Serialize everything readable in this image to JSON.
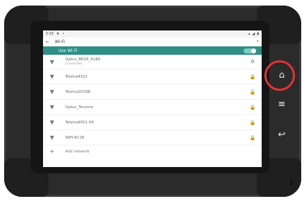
{
  "status_bar": {
    "time": "5:33",
    "left_icons": [
      "gear-icon",
      "pin-icon"
    ],
    "right_icons": [
      "wifi-icon",
      "signal-icon",
      "battery-icon"
    ]
  },
  "app_bar": {
    "back_icon": "back-arrow-icon",
    "title": "Wi-Fi",
    "search_icon": "search-icon"
  },
  "use_wifi": {
    "label": "Use Wi-Fi",
    "enabled": true
  },
  "networks": [
    {
      "name": "Optus_BR16_4180",
      "status": "Connected",
      "connected": true
    },
    {
      "name": "Telstra4321"
    },
    {
      "name": "Telstra2D298"
    },
    {
      "name": "Optus_Tecoma"
    },
    {
      "name": "Telstra4001-56"
    },
    {
      "name": "WiFi-6C26"
    }
  ],
  "add_network": {
    "label": "Add network"
  },
  "hardware_buttons": {
    "home": "home-icon",
    "menu": "menu-icon",
    "back": "back-icon"
  },
  "colors": {
    "accent": "#2f8f86",
    "highlight_ring": "#e53333"
  }
}
